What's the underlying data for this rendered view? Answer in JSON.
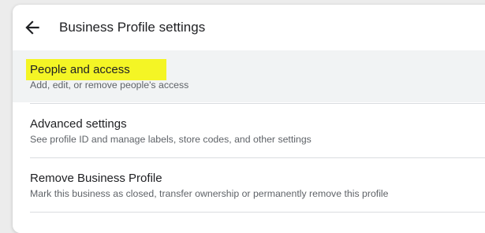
{
  "header": {
    "back_icon": "arrow-back-icon",
    "title": "Business Profile settings"
  },
  "items": [
    {
      "title": "People and access",
      "subtitle": "Add, edit, or remove people's access",
      "active": true,
      "highlighted": true,
      "highlight_color": "#f5f500"
    },
    {
      "title": "Advanced settings",
      "subtitle": "See profile ID and manage labels, store codes, and other settings"
    },
    {
      "title": "Remove Business Profile",
      "subtitle": "Mark this business as closed, transfer ownership or permanently remove this profile"
    }
  ],
  "colors": {
    "text_primary": "#202124",
    "text_secondary": "#5f6368",
    "active_background": "#f1f3f4",
    "divider": "#dadce0"
  }
}
